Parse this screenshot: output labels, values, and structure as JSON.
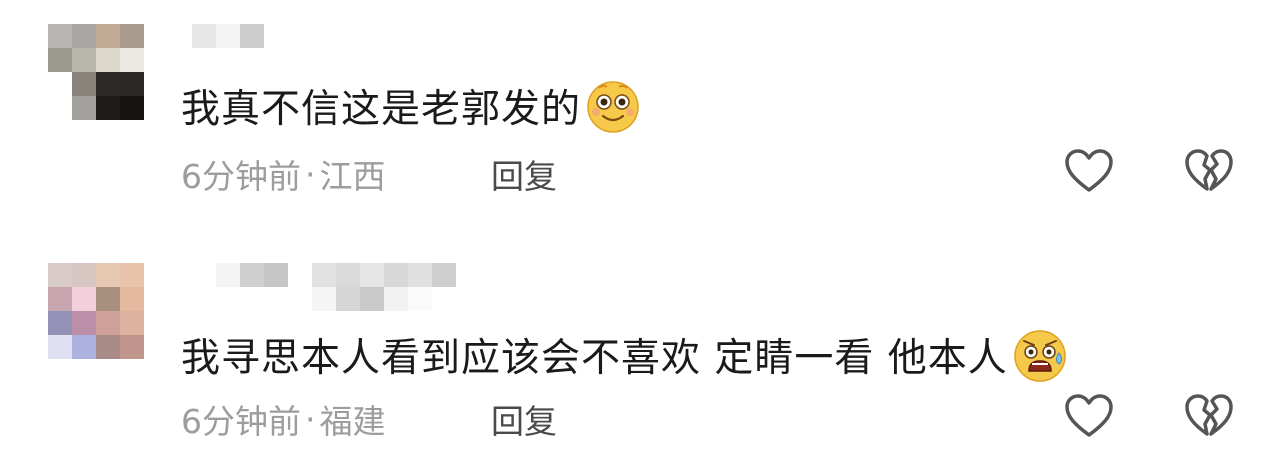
{
  "comments": [
    {
      "text": "我真不信这是老郭发的",
      "emoji": "smiling-face-emoji",
      "time": "6分钟前",
      "separator": "·",
      "location": "江西",
      "reply_label": "回复",
      "like_icon": "heart-outline-icon",
      "dislike_icon": "broken-heart-outline-icon"
    },
    {
      "text": "我寻思本人看到应该会不喜欢 定睛一看 他本人",
      "emoji": "shocked-sweat-face-emoji",
      "time": "6分钟前",
      "separator": "·",
      "location": "福建",
      "reply_label": "回复",
      "like_icon": "heart-outline-icon",
      "dislike_icon": "broken-heart-outline-icon"
    }
  ],
  "colors": {
    "comment_text": "#1a1a1a",
    "meta_text": "#9d9d9d",
    "reply_text": "#4a4a4a",
    "icon_stroke": "#555555",
    "emoji_yellow": "#f7c94a"
  }
}
